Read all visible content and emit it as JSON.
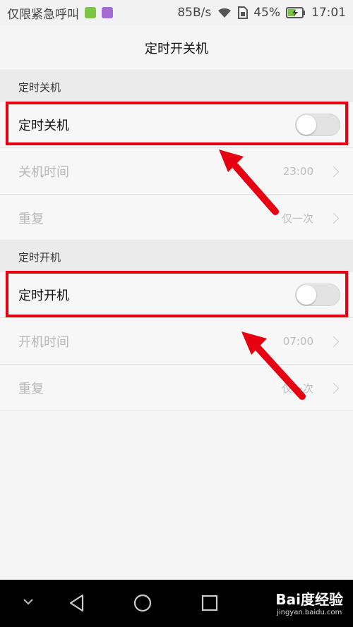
{
  "status_bar": {
    "carrier_text": "仅限紧急呼叫",
    "network_speed": "85B/s",
    "battery_percent": "45%",
    "time": "17:01",
    "icons": [
      "app-wechat-icon",
      "app-gallery-icon",
      "wifi-icon",
      "sim-icon",
      "battery-charging-icon"
    ]
  },
  "header": {
    "title": "定时开关机"
  },
  "sections": [
    {
      "header": "定时关机",
      "toggle_row": {
        "label": "定时关机",
        "enabled": false
      },
      "time_row": {
        "label": "关机时间",
        "value": "23:00"
      },
      "repeat_row": {
        "label": "重复",
        "value": "仅一次"
      }
    },
    {
      "header": "定时开机",
      "toggle_row": {
        "label": "定时开机",
        "enabled": false
      },
      "time_row": {
        "label": "开机时间",
        "value": "07:00"
      },
      "repeat_row": {
        "label": "重复",
        "value": "仅一次"
      }
    }
  ],
  "nav_bar": {
    "icons": [
      "chevron-down-icon",
      "back-icon",
      "home-icon",
      "recents-icon"
    ],
    "watermark": {
      "brand": "Bai度经验",
      "url": "jingyan.baidu.com"
    }
  },
  "colors": {
    "highlight": "#e60012",
    "arrow": "#e60012"
  }
}
